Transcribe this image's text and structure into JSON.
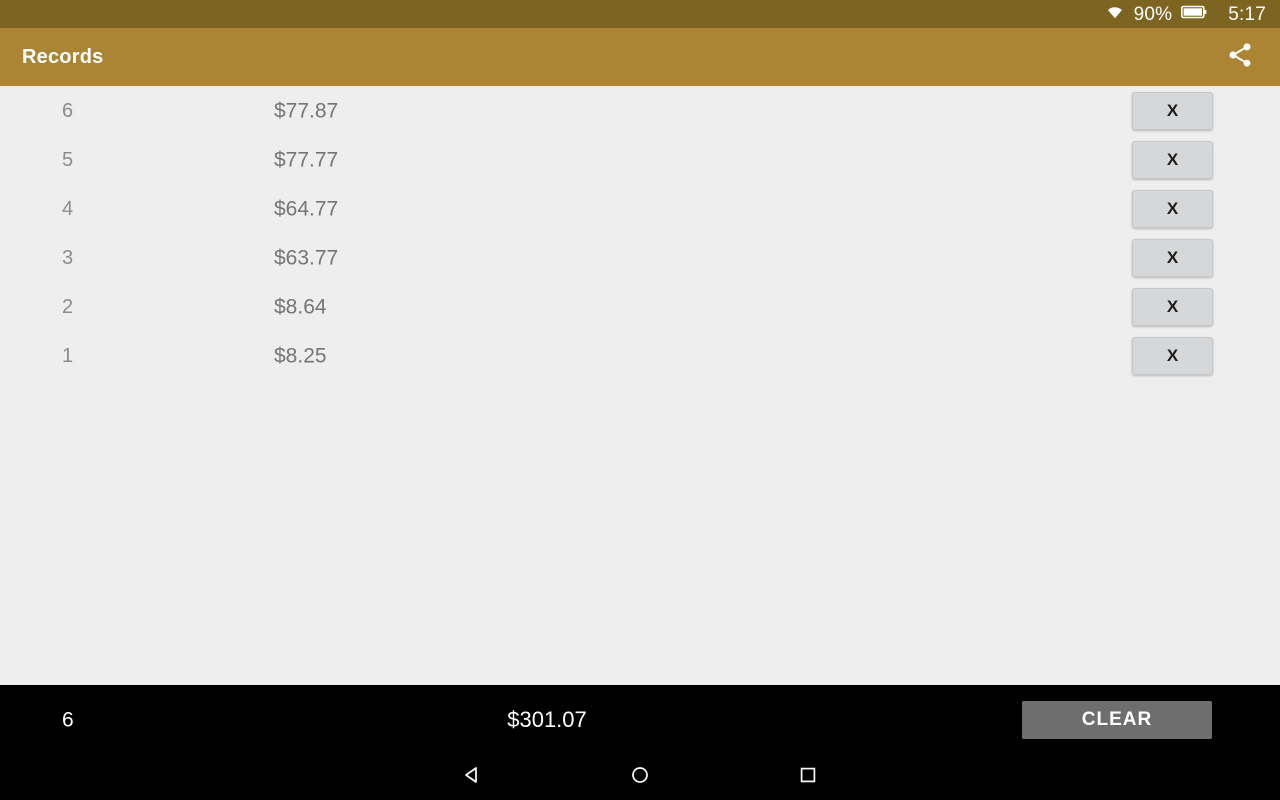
{
  "status_bar": {
    "wifi_icon": "wifi-icon",
    "battery_percent": "90%",
    "battery_icon": "battery-icon",
    "time": "5:17",
    "background_color": "#7e6421"
  },
  "app_bar": {
    "title": "Records",
    "share_icon": "share-icon",
    "background_color": "#ab8434",
    "text_color": "#ffffff"
  },
  "records": {
    "columns": [
      "index",
      "amount",
      "action"
    ],
    "delete_label": "X",
    "rows": [
      {
        "index": "6",
        "amount": "$77.87",
        "delete": "X"
      },
      {
        "index": "5",
        "amount": "$77.77",
        "delete": "X"
      },
      {
        "index": "4",
        "amount": "$64.77",
        "delete": "X"
      },
      {
        "index": "3",
        "amount": "$63.77",
        "delete": "X"
      },
      {
        "index": "2",
        "amount": "$8.64",
        "delete": "X"
      },
      {
        "index": "1",
        "amount": "$8.25",
        "delete": "X"
      }
    ]
  },
  "summary_bar": {
    "count": "6",
    "total": "$301.07",
    "clear_label": "CLEAR",
    "background_color": "#000000",
    "clear_button_color": "#6e6e6e"
  },
  "nav_bar": {
    "back_icon": "back-triangle-icon",
    "home_icon": "home-circle-icon",
    "recents_icon": "recents-square-icon"
  }
}
